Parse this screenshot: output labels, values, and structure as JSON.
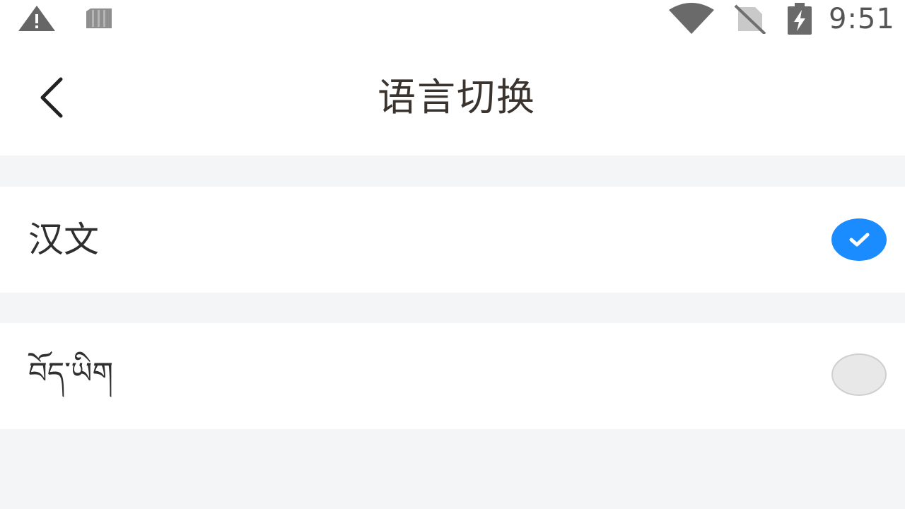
{
  "status_bar": {
    "time": "9:51",
    "icons": [
      "warning-icon",
      "sim-card-icon",
      "wifi-icon",
      "no-sim-icon",
      "battery-charging-icon"
    ]
  },
  "header": {
    "title": "语言切换",
    "back_icon": "chevron-left-icon"
  },
  "languages": [
    {
      "label": "汉文",
      "selected": true
    },
    {
      "label": "བོད་ཡིག",
      "selected": false
    }
  ],
  "colors": {
    "accent": "#1a8cff",
    "background": "#f4f5f7",
    "surface": "#ffffff",
    "radio_unselected": "#e8e8e8"
  }
}
